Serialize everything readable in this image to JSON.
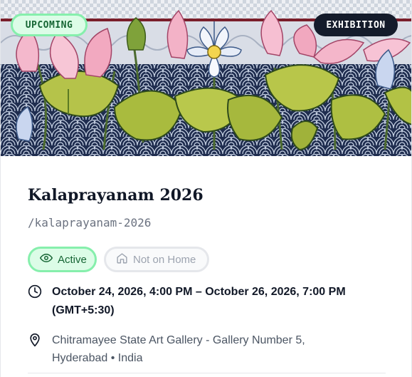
{
  "event": {
    "status_badge": "UPCOMING",
    "type_badge": "EXHIBITION",
    "title": "Kalaprayanam 2026",
    "slug": "/kalaprayanam-2026",
    "active_label": "Active",
    "home_label": "Not on Home",
    "date_line1": "October 24, 2026, 4:00 PM – October 26, 2026, 7:00 PM",
    "date_line2": "(GMT+5:30)",
    "location_line1": "Chitramayee State Art Gallery - Gallery Number 5,",
    "location_line2": "Hyderabad • India"
  },
  "icons": {
    "active": "eye-icon",
    "home": "home-icon",
    "date": "clock-icon",
    "location": "map-pin-icon"
  },
  "colors": {
    "status_badge_bg": "#dcfce7",
    "status_badge_border": "#86efac",
    "status_badge_text": "#166534",
    "type_badge_bg": "#141b2b",
    "title_text": "#111827",
    "slug_text": "#6b7280",
    "muted_pill_text": "#9ca3af"
  }
}
